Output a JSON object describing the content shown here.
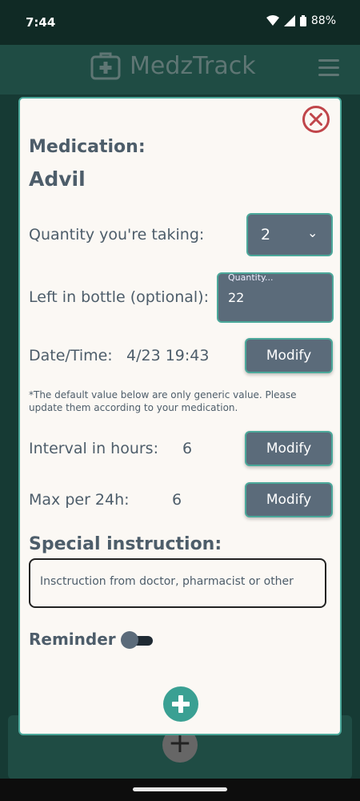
{
  "status": {
    "time": "7:44",
    "battery": "88%"
  },
  "app": {
    "brand": "MedzTrack"
  },
  "form": {
    "medication_label": "Medication:",
    "medication_name": "Advil",
    "quantity_label": "Quantity you're taking:",
    "quantity_value": "2",
    "left_label": "Left in bottle (optional):",
    "left_hint": "Quantity...",
    "left_value": "22",
    "datetime_label": "Date/Time:",
    "datetime_value": "4/23 19:43",
    "modify_label": "Modify",
    "note": "*The default value below are only generic value. Please update them according to your medication.",
    "interval_label": "Interval in hours:",
    "interval_value": "6",
    "max_label": "Max per 24h:",
    "max_value": "6",
    "special_label": "Special instruction:",
    "special_placeholder": "Insctruction from doctor,  pharmacist or other",
    "reminder_label": "Reminder",
    "reminder_on": false
  },
  "colors": {
    "accent": "#4ba89a",
    "button": "#5b6b7a",
    "close": "#c0454a",
    "add": "#3aa093"
  }
}
